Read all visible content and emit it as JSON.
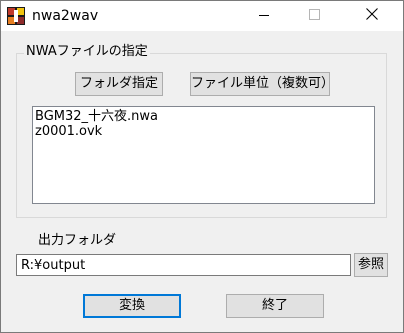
{
  "window": {
    "title": "nwa2wav",
    "icons": {
      "app": "app-icon",
      "minimize": "minimize-icon",
      "maximize": "maximize-icon",
      "close": "close-icon"
    }
  },
  "nwa_group": {
    "label": "NWAファイルの指定",
    "folder_button": "フォルダ指定",
    "file_button": "ファイル単位（複数可）",
    "files": [
      "BGM32_十六夜.nwa",
      "z0001.ovk"
    ]
  },
  "output": {
    "label": "出力フォルダ",
    "path": "R:¥output",
    "browse_button": "参照"
  },
  "actions": {
    "convert_button": "変換",
    "exit_button": "終了"
  },
  "colors": {
    "focus_border": "#0078d7",
    "window_bg": "#f0f0f0"
  }
}
